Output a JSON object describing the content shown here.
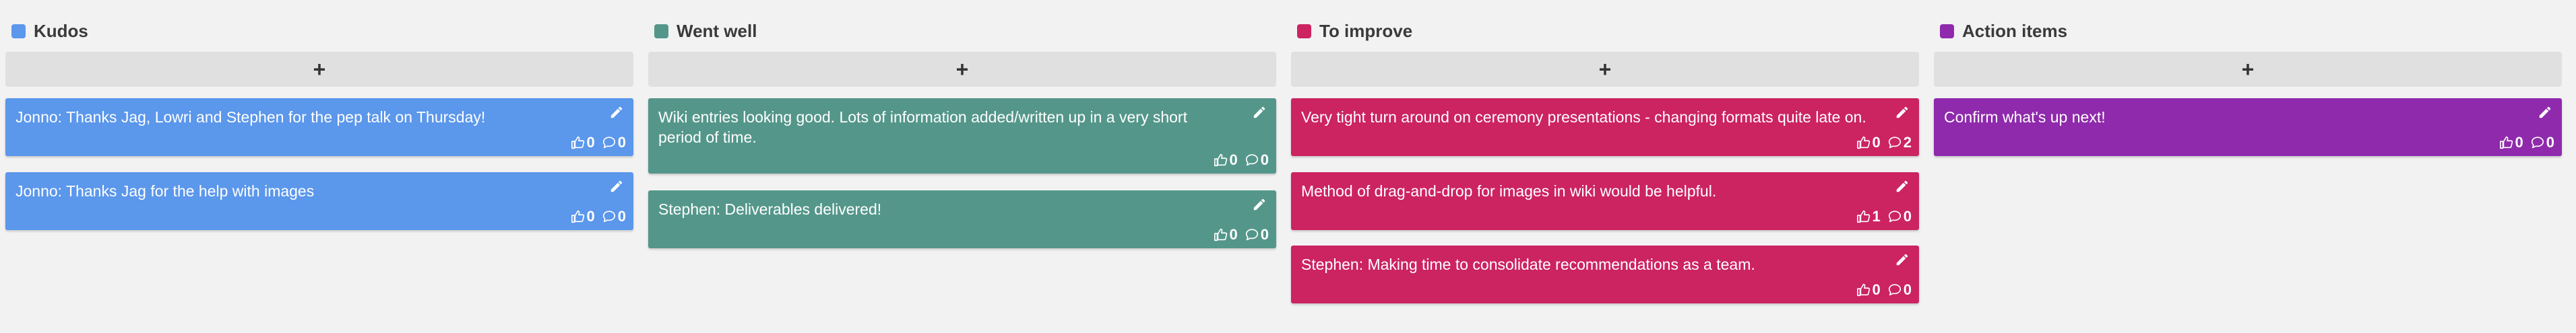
{
  "columns": [
    {
      "title": "Kudos",
      "color": "#5b97eb",
      "add_label": "+",
      "cards": [
        {
          "text": "Jonno: Thanks Jag, Lowri and Stephen for the pep talk on Thursday!",
          "likes": "0",
          "comments": "0"
        },
        {
          "text": "Jonno: Thanks Jag for the help with images",
          "likes": "0",
          "comments": "0"
        }
      ]
    },
    {
      "title": "Went well",
      "color": "#54978a",
      "add_label": "+",
      "cards": [
        {
          "text": "Wiki entries looking good. Lots of information added/written up in a very short period of time.",
          "likes": "0",
          "comments": "0"
        },
        {
          "text": "Stephen: Deliverables delivered!",
          "likes": "0",
          "comments": "0"
        }
      ]
    },
    {
      "title": "To improve",
      "color": "#cc2361",
      "add_label": "+",
      "cards": [
        {
          "text": "Very tight turn around on ceremony presentations - changing formats quite late on.",
          "likes": "0",
          "comments": "2"
        },
        {
          "text": "Method of drag-and-drop for images in wiki would be helpful.",
          "likes": "1",
          "comments": "0"
        },
        {
          "text": "Stephen: Making time to consolidate recommendations as a team.",
          "likes": "0",
          "comments": "0"
        }
      ]
    },
    {
      "title": "Action items",
      "color": "#8f2aac",
      "add_label": "+",
      "cards": [
        {
          "text": "Confirm what's up next!",
          "likes": "0",
          "comments": "0"
        }
      ]
    }
  ],
  "icons": {
    "edit": "pencil-icon",
    "like": "thumbs-up-icon",
    "comment": "comment-icon"
  }
}
